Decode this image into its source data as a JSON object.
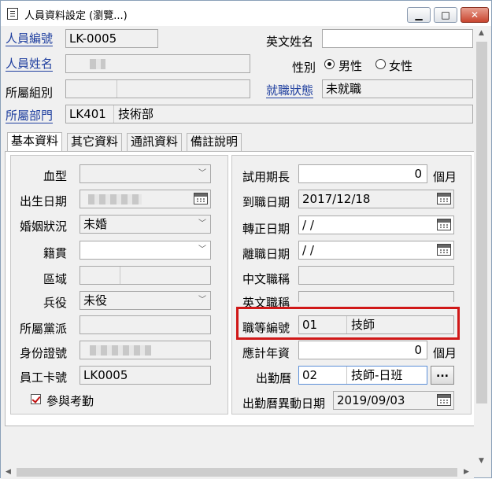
{
  "window": {
    "title": "人員資料設定 (瀏覽...)",
    "minimize": "▁",
    "maximize": "□",
    "close": "✕"
  },
  "header": {
    "emp_no_label": "人員編號",
    "emp_no": "LK-0005",
    "en_name_label": "英文姓名",
    "en_name": "",
    "name_label": "人員姓名",
    "gender_label": "性別",
    "gender_options": [
      "男性",
      "女性"
    ],
    "gender_selected": "男性",
    "group_label": "所屬組別",
    "job_status_label": "就職狀態",
    "job_status": "未就職",
    "dept_label": "所屬部門",
    "dept_code": "LK401",
    "dept_name": "技術部"
  },
  "tabs": [
    {
      "label": "基本資料",
      "active": true
    },
    {
      "label": "其它資料",
      "active": false
    },
    {
      "label": "通訊資料",
      "active": false
    },
    {
      "label": "備註說明",
      "active": false
    }
  ],
  "left": {
    "blood_label": "血型",
    "blood": "",
    "birth_label": "出生日期",
    "marital_label": "婚姻狀況",
    "marital": "未婚",
    "native_label": "籍貫",
    "native": "",
    "region_label": "區域",
    "military_label": "兵役",
    "military": "未役",
    "party_label": "所屬黨派",
    "id_label": "身份證號",
    "card_label": "員工卡號",
    "card": "LK0005",
    "attend_label": "參與考勤"
  },
  "right": {
    "probation_label": "試用期長",
    "probation": "0",
    "probation_unit": "個月",
    "arrive_label": "到職日期",
    "arrive": "2017/12/18",
    "regular_label": "轉正日期",
    "regular": " / /",
    "leave_label": "離職日期",
    "leave": " / /",
    "cn_title_label": "中文職稱",
    "en_title_label": "英文職稱",
    "grade_label": "職等編號",
    "grade_code": "01",
    "grade_name": "技師",
    "seniority_label": "應計年資",
    "seniority": "0",
    "seniority_unit": "個月",
    "calendar_label": "出勤曆",
    "calendar_code": "02",
    "calendar_name": "技師-日班",
    "calendar_btn": "...",
    "cal_change_label": "出勤曆異動日期",
    "cal_change": "2019/09/03"
  }
}
